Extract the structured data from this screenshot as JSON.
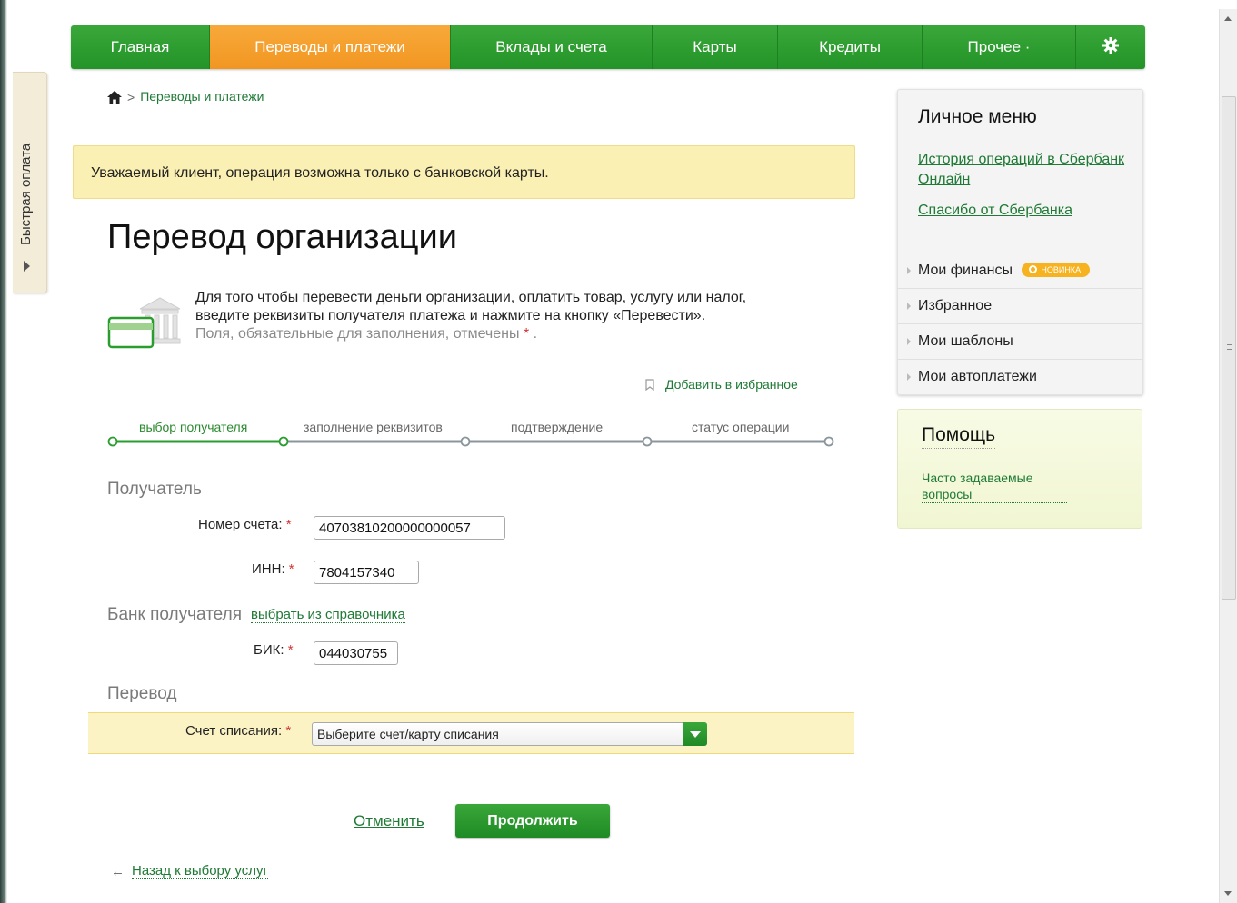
{
  "quick_pay": {
    "label": "Быстрая оплата"
  },
  "nav": {
    "items": [
      {
        "label": "Главная",
        "width": 153
      },
      {
        "label": "Переводы и платежи",
        "width": 265,
        "active": true
      },
      {
        "label": "Вклады и счета",
        "width": 222
      },
      {
        "label": "Карты",
        "width": 138
      },
      {
        "label": "Кредиты",
        "width": 159
      },
      {
        "label": "Прочее ·",
        "width": 169
      },
      {
        "label": "",
        "width": 76,
        "icon": "gear-icon"
      }
    ]
  },
  "breadcrumb": {
    "separator": ">",
    "link": "Переводы и платежи"
  },
  "warning": {
    "text": "Уважаемый клиент, операция возможна только с банковской карты."
  },
  "page_title": "Перевод организации",
  "intro": {
    "line1": "Для того чтобы перевести деньги организации, оплатить товар, услугу или налог,",
    "line2": "введите реквизиты получателя платежа и нажмите на кнопку «Перевести».",
    "note": "Поля, обязательные для заполнения, отмечены",
    "note_star": "*",
    "note_end": "."
  },
  "favorites": {
    "label": "Добавить в избранное"
  },
  "steps": {
    "items": [
      {
        "label": "выбор получателя",
        "active": true
      },
      {
        "label": "заполнение реквизитов"
      },
      {
        "label": "подтверждение"
      },
      {
        "label": "статус операции"
      }
    ]
  },
  "form": {
    "recipient_section": "Получатель",
    "account_label": "Номер счета:",
    "account_value": "40703810200000000057",
    "inn_label": "ИНН:",
    "inn_value": "7804157340",
    "bank_section": "Банк получателя",
    "bank_link": "выбрать из справочника",
    "bik_label": "БИК:",
    "bik_value": "044030755",
    "transfer_section": "Перевод",
    "debit_label": "Счет списания:",
    "debit_value": "Выберите счет/карту списания",
    "required_mark": "*"
  },
  "actions": {
    "cancel": "Отменить",
    "continue": "Продолжить",
    "back": "Назад к выбору услуг",
    "back_arrow": "←"
  },
  "personal_menu": {
    "title": "Личное меню",
    "link1": "История операций в Сбербанк Онлайн",
    "link2": "Спасибо от Сбербанка",
    "items": [
      {
        "label": "Мои финансы",
        "badge": "новинка"
      },
      {
        "label": "Избранное"
      },
      {
        "label": "Мои шаблоны"
      },
      {
        "label": "Мои автоплатежи"
      }
    ]
  },
  "help": {
    "title": "Помощь",
    "link": "Часто задаваемые вопросы"
  },
  "colors": {
    "brand_green": "#2a9d2f",
    "active_orange": "#f29622",
    "warning_bg": "#fbf0b3"
  }
}
